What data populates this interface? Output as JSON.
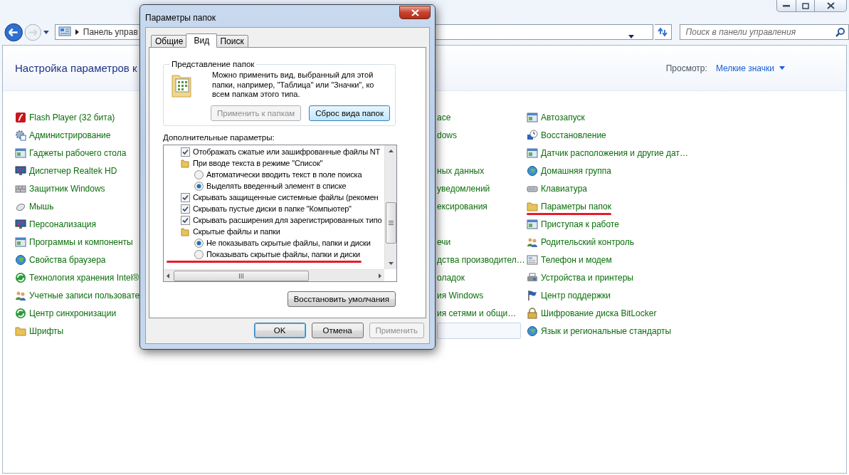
{
  "address_bar": {
    "path": "Панель управ"
  },
  "search": {
    "placeholder": "Поиск в панели управления"
  },
  "header": {
    "title": "Настройка параметров к",
    "view_label": "Просмотр:",
    "view_value": "Мелкие значки"
  },
  "columns": [
    {
      "icons": true,
      "items": [
        {
          "label": "Flash Player (32 бита)",
          "selected": false
        },
        {
          "label": "Администрирование",
          "selected": false
        },
        {
          "label": "Гаджеты рабочего стола",
          "selected": false
        },
        {
          "label": "Диспетчер Realtek HD",
          "selected": false
        },
        {
          "label": "Защитник Windows",
          "selected": false
        },
        {
          "label": "Мышь",
          "selected": false
        },
        {
          "label": "Персонализация",
          "selected": false
        },
        {
          "label": "Программы и компоненты",
          "selected": false
        },
        {
          "label": "Свойства браузера",
          "selected": false
        },
        {
          "label": "Технология хранения Intel®",
          "selected": false
        },
        {
          "label": "Учетные записи пользовате",
          "selected": false
        },
        {
          "label": "Центр синхронизации",
          "selected": false
        },
        {
          "label": "Шрифты",
          "selected": false
        }
      ]
    },
    {
      "icons": false,
      "items": [
        {
          "label": "ace",
          "selected": false
        },
        {
          "label": "dows",
          "selected": false
        },
        {
          "selected": false
        },
        {
          "label": "ных данных",
          "selected": false
        },
        {
          "label": "уведомлений",
          "selected": false
        },
        {
          "label": "ексирования",
          "selected": false
        },
        {
          "selected": false
        },
        {
          "label": "ечи",
          "selected": false
        },
        {
          "label": "дства производител…",
          "selected": false
        },
        {
          "label": "оладок",
          "selected": false
        },
        {
          "label": "ия Windows",
          "selected": false
        },
        {
          "label": "ия сетями и общи…",
          "selected": false
        },
        {
          "selected": true
        }
      ]
    },
    {
      "icons": true,
      "items": [
        {
          "label": "Автозапуск",
          "selected": false
        },
        {
          "label": "Восстановление",
          "selected": false
        },
        {
          "label": "Датчик расположения и другие дат…",
          "selected": false
        },
        {
          "label": "Домашняя группа",
          "selected": false
        },
        {
          "label": "Клавиатура",
          "selected": false
        },
        {
          "label": "Параметры папок",
          "selected": false,
          "underlined": true
        },
        {
          "label": "Приступая к работе",
          "selected": false
        },
        {
          "label": "Родительский контроль",
          "selected": false
        },
        {
          "label": "Телефон и модем",
          "selected": false
        },
        {
          "label": "Устройства и принтеры",
          "selected": false
        },
        {
          "label": "Центр поддержки",
          "selected": false
        },
        {
          "label": "Шифрование диска BitLocker",
          "selected": false
        },
        {
          "label": "Язык и региональные стандарты",
          "selected": false
        }
      ]
    }
  ],
  "dialog": {
    "title": "Параметры папок",
    "tabs": [
      {
        "label": "Общие",
        "selected": false
      },
      {
        "label": "Вид",
        "selected": true
      },
      {
        "label": "Поиск",
        "selected": false
      }
    ],
    "group": {
      "title": "Представление папок",
      "text": "Можно применить вид, выбранный для этой папки, например, \"Таблица\" или \"Значки\", ко всем папкам этого типа.",
      "buttons": [
        {
          "label": "Применить к папкам",
          "disabled": true,
          "focused": false
        },
        {
          "label": "Сброс вида папок",
          "disabled": false,
          "focused": true
        }
      ]
    },
    "advanced_label": "Дополнительные параметры:",
    "options": [
      {
        "kind": "checkbox",
        "label": "Отображать сжатые или зашифрованные файлы NT",
        "checked": true
      },
      {
        "kind": "group",
        "label": "При вводе текста в режиме \"Список\"",
        "children": [
          {
            "kind": "radio",
            "label": "Автоматически вводить текст в поле поиска",
            "selected": false
          },
          {
            "kind": "radio",
            "label": "Выделять введенный элемент в списке",
            "selected": true
          }
        ]
      },
      {
        "kind": "checkbox",
        "label": "Скрывать защищенные системные файлы (рекомен",
        "checked": true
      },
      {
        "kind": "checkbox",
        "label": "Скрывать пустые диски в папке \"Компьютер\"",
        "checked": true
      },
      {
        "kind": "checkbox",
        "label": "Скрывать расширения для зарегистрированных типо",
        "checked": true
      },
      {
        "kind": "group",
        "label": "Скрытые файлы и папки",
        "children": [
          {
            "kind": "radio",
            "label": "Не показывать скрытые файлы, папки и диски",
            "selected": true
          },
          {
            "kind": "radio",
            "label": "Показывать скрытые файлы, папки и диски",
            "selected": false,
            "underlined": true
          }
        ]
      }
    ],
    "restore_button": "Восстановить умолчания",
    "buttons": [
      {
        "label": "OK",
        "disabled": false,
        "focused": true
      },
      {
        "label": "Отмена",
        "disabled": false,
        "focused": false
      },
      {
        "label": "Применить",
        "disabled": true,
        "focused": false
      }
    ]
  }
}
